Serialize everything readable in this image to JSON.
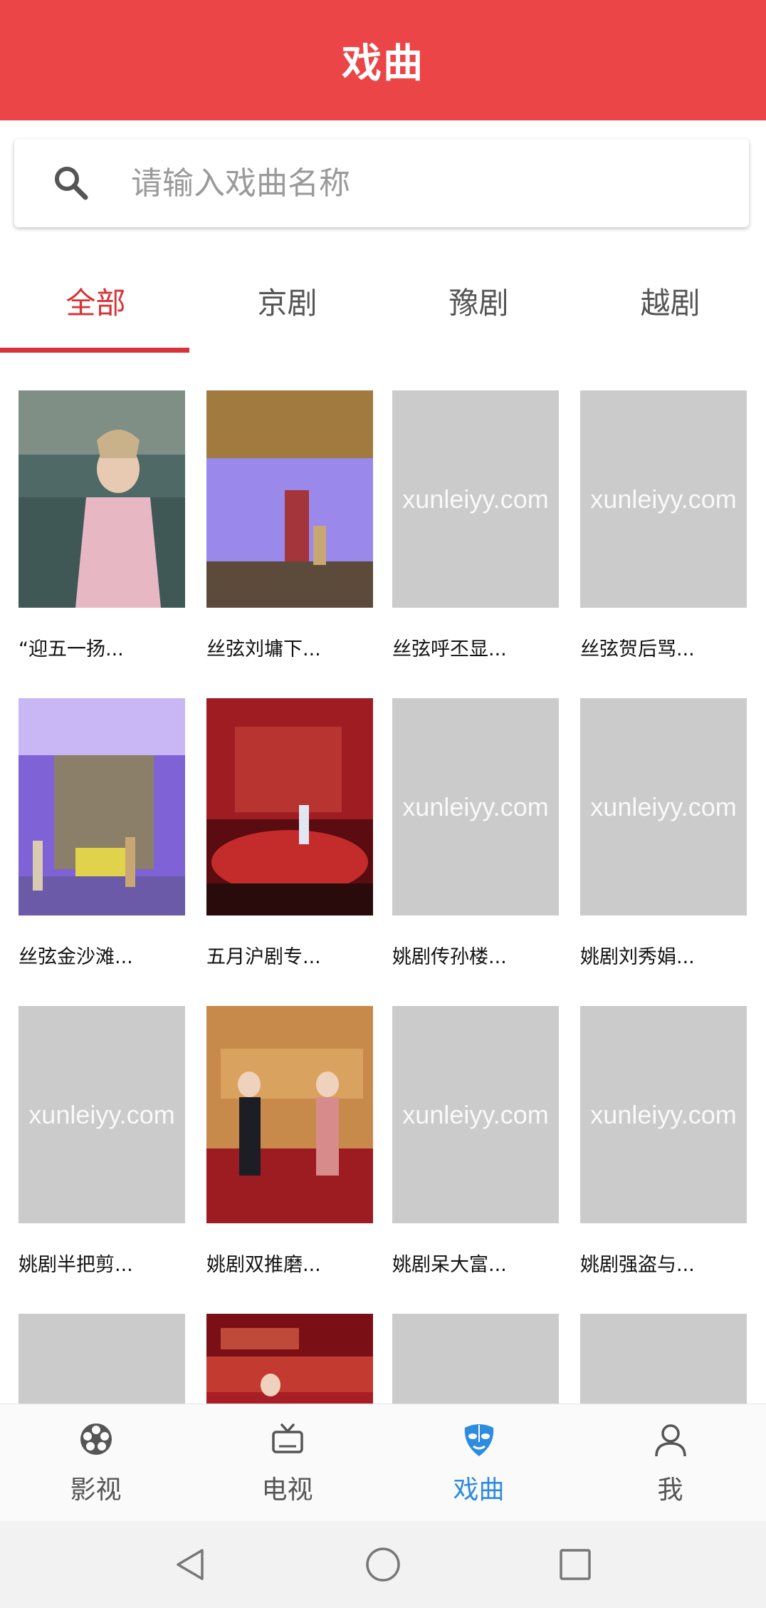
{
  "header": {
    "title": "戏曲"
  },
  "search": {
    "placeholder": "请输入戏曲名称",
    "value": "",
    "icon": "search-icon"
  },
  "tabs": [
    {
      "label": "全部",
      "active": true
    },
    {
      "label": "京剧",
      "active": false
    },
    {
      "label": "豫剧",
      "active": false
    },
    {
      "label": "越剧",
      "active": false
    }
  ],
  "accent_color": "#EB4548",
  "tab_active_color": "#D83236",
  "nav_active_color": "#2D8BE0",
  "placeholder_watermark": "xunleiyy.com",
  "grid": {
    "items": [
      {
        "title": "“迎五一扬...",
        "thumb": "stage-photo-opera-singer"
      },
      {
        "title": "丝弦刘墉下...",
        "thumb": "stage-photo-empty-stage"
      },
      {
        "title": "丝弦呼丕显...",
        "thumb": "placeholder"
      },
      {
        "title": "丝弦贺后骂...",
        "thumb": "placeholder"
      },
      {
        "title": "丝弦金沙滩...",
        "thumb": "stage-photo-purple-stage"
      },
      {
        "title": "五月沪剧专...",
        "thumb": "stage-photo-red-stage"
      },
      {
        "title": "姚剧传孙楼...",
        "thumb": "placeholder"
      },
      {
        "title": "姚剧刘秀娟...",
        "thumb": "placeholder"
      },
      {
        "title": "姚剧半把剪...",
        "thumb": "placeholder"
      },
      {
        "title": "姚剧双推磨...",
        "thumb": "stage-photo-red-banner"
      },
      {
        "title": "姚剧呆大富...",
        "thumb": "placeholder"
      },
      {
        "title": "姚剧强盗与...",
        "thumb": "placeholder"
      },
      {
        "title": "",
        "thumb": "placeholder"
      },
      {
        "title": "",
        "thumb": "stage-photo-red-banner-2"
      },
      {
        "title": "",
        "thumb": "placeholder"
      },
      {
        "title": "",
        "thumb": "placeholder"
      }
    ]
  },
  "bottom_nav": [
    {
      "label": "影视",
      "icon": "film-reel-icon",
      "active": false
    },
    {
      "label": "电视",
      "icon": "tv-icon",
      "active": false
    },
    {
      "label": "戏曲",
      "icon": "opera-mask-icon",
      "active": true
    },
    {
      "label": "我",
      "icon": "user-icon",
      "active": false
    }
  ],
  "system_nav": [
    "back-icon",
    "home-icon",
    "recents-icon"
  ]
}
